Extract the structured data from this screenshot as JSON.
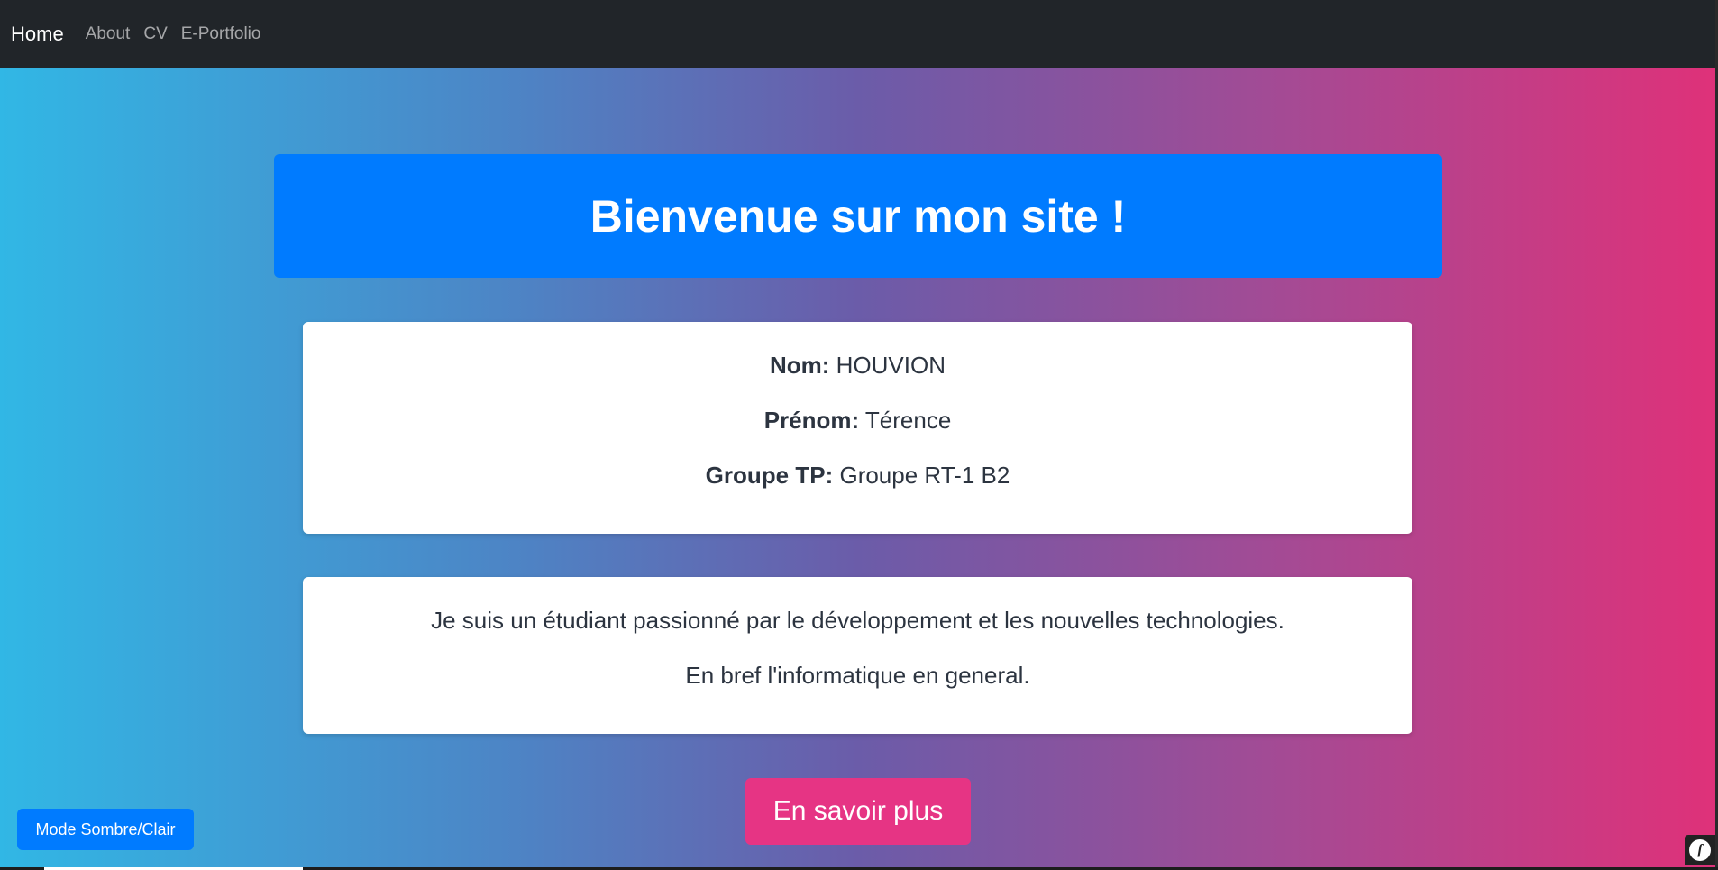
{
  "navbar": {
    "brand": "Home",
    "links": [
      "About",
      "CV",
      "E-Portfolio"
    ]
  },
  "hero": {
    "title": "Bienvenue sur mon site !"
  },
  "info": {
    "nom_label": "Nom:",
    "nom_value": "HOUVION",
    "prenom_label": "Prénom:",
    "prenom_value": "Térence",
    "groupe_label": "Groupe TP:",
    "groupe_value": "Groupe RT-1 B2"
  },
  "about": {
    "line1": "Je suis un étudiant passionné par le développement et les nouvelles technologies.",
    "line2": "En bref l'informatique en general."
  },
  "cta": {
    "label": "En savoir plus"
  },
  "mode_toggle": {
    "label": "Mode Sombre/Clair"
  },
  "symfony_toolbar": {
    "icon": "symfony-logo-icon"
  },
  "colors": {
    "navbar": "#212529",
    "hero": "#007bff",
    "cta": "#e63484",
    "gradient_start": "#31b7e5",
    "gradient_end": "#df3179"
  }
}
